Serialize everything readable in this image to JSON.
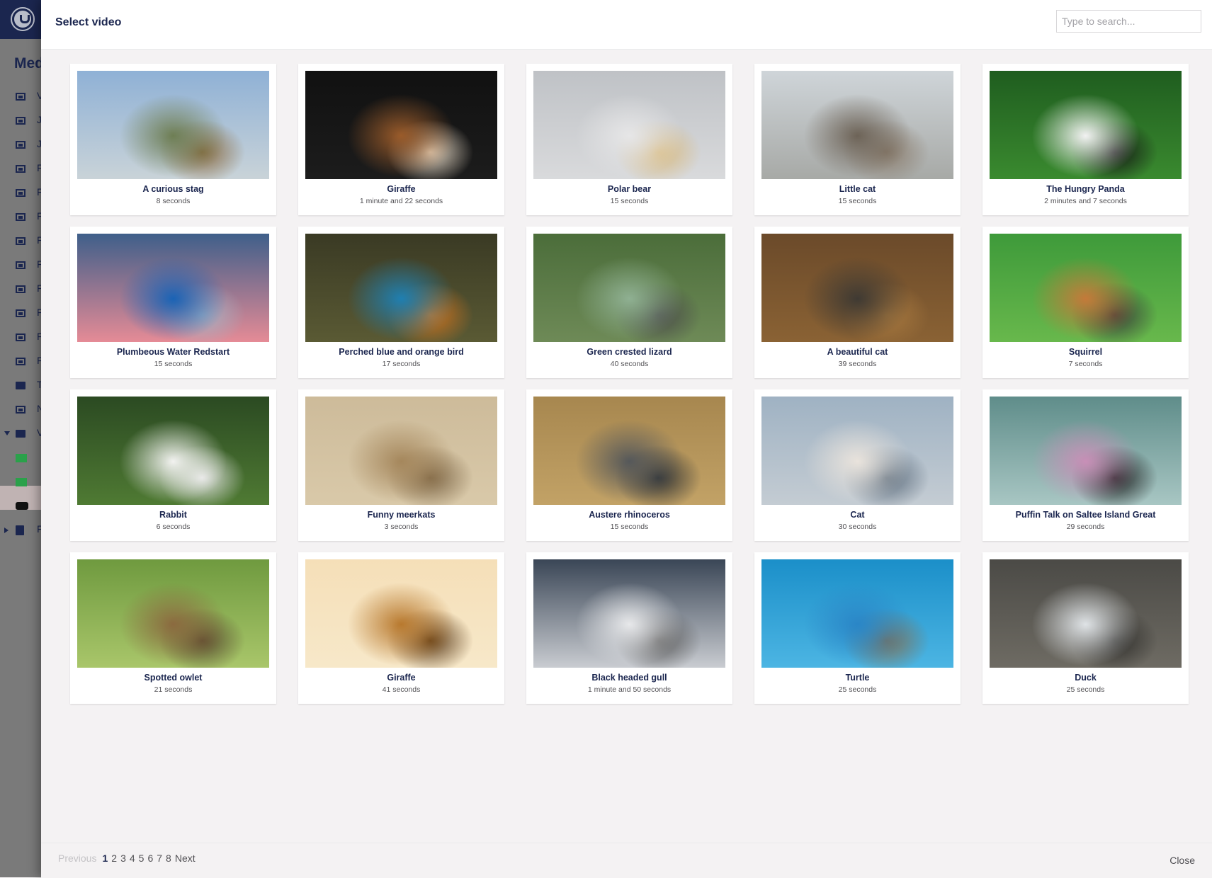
{
  "background_app": {
    "section_heading": "Med",
    "tree_letters": [
      "V",
      "J",
      "J",
      "F",
      "F",
      "F",
      "F",
      "F",
      "F",
      "F",
      "F",
      "F",
      "T",
      "N",
      "V",
      "",
      "",
      "",
      "F"
    ]
  },
  "modal": {
    "title": "Select video",
    "search": {
      "placeholder": "Type to search...",
      "value": ""
    },
    "videos": [
      {
        "name": "A curious stag",
        "duration": "8 seconds",
        "palette": [
          "#8fb1d6",
          "#c9d3d8",
          "#6e7e54",
          "#8a6a3f"
        ]
      },
      {
        "name": "Giraffe",
        "duration": "1 minute and 22 seconds",
        "palette": [
          "#111111",
          "#1c1c1c",
          "#9a5b2a",
          "#e9dcc8"
        ]
      },
      {
        "name": "Polar bear",
        "duration": "15 seconds",
        "palette": [
          "#bfc2c6",
          "#d9dadc",
          "#e6e6e7",
          "#d8b97c"
        ]
      },
      {
        "name": "Little cat",
        "duration": "15 seconds",
        "palette": [
          "#cfd5d9",
          "#a7a9a6",
          "#6d6357",
          "#8a7c6c"
        ]
      },
      {
        "name": "The Hungry Panda",
        "duration": "2 minutes and 7 seconds",
        "palette": [
          "#1f5d1f",
          "#3a8a2f",
          "#f2f2f2",
          "#141414"
        ]
      },
      {
        "name": "Plumbeous Water Redstart",
        "duration": "15 seconds",
        "palette": [
          "#3f5f8a",
          "#e58b96",
          "#1a63b5",
          "#a6b1c2"
        ]
      },
      {
        "name": "Perched blue and orange bird",
        "duration": "17 seconds",
        "palette": [
          "#3a3a24",
          "#5a5a34",
          "#1f7fb1",
          "#d0741f"
        ]
      },
      {
        "name": "Green crested lizard",
        "duration": "40 seconds",
        "palette": [
          "#4b6d3a",
          "#6e8a57",
          "#8fb092",
          "#4a4a4a"
        ]
      },
      {
        "name": "A beautiful cat",
        "duration": "39 seconds",
        "palette": [
          "#6b4a2a",
          "#8a6234",
          "#3f3a33",
          "#a8793f"
        ]
      },
      {
        "name": "Squirrel",
        "duration": "7 seconds",
        "palette": [
          "#3e9a3a",
          "#68b84c",
          "#c47a3a",
          "#3a3a3a"
        ]
      },
      {
        "name": "Rabbit",
        "duration": "6 seconds",
        "palette": [
          "#2b4a22",
          "#4f7a33",
          "#f2f2f0",
          "#e5e5e5"
        ]
      },
      {
        "name": "Funny meerkats",
        "duration": "3 seconds",
        "palette": [
          "#cdbb9a",
          "#d9c9a9",
          "#a5875c",
          "#7d6646"
        ]
      },
      {
        "name": "Austere rhinoceros",
        "duration": "15 seconds",
        "palette": [
          "#a7874f",
          "#c2a266",
          "#55585a",
          "#2f3234"
        ]
      },
      {
        "name": "Cat",
        "duration": "30 seconds",
        "palette": [
          "#9fb2c3",
          "#c4ccd3",
          "#e9e3dc",
          "#5a6a7a"
        ]
      },
      {
        "name": "Puffin Talk on Saltee Island Great",
        "duration": "29 seconds",
        "palette": [
          "#5f8d8a",
          "#a8c6c3",
          "#c88fb7",
          "#1a1a1a"
        ]
      },
      {
        "name": "Spotted owlet",
        "duration": "21 seconds",
        "palette": [
          "#6f9a3f",
          "#a9c66a",
          "#8b6a3f",
          "#5a4a30"
        ]
      },
      {
        "name": "Giraffe",
        "duration": "41 seconds",
        "palette": [
          "#f5dfb8",
          "#f7e8c9",
          "#b8792e",
          "#5a3a18"
        ]
      },
      {
        "name": "Black headed gull",
        "duration": "1 minute and 50 seconds",
        "palette": [
          "#3a4656",
          "#c9ccd1",
          "#e7e8ea",
          "#5a5a5a"
        ]
      },
      {
        "name": "Turtle",
        "duration": "25 seconds",
        "palette": [
          "#1b8fc9",
          "#4cb5e3",
          "#2a86c7",
          "#7e6f55"
        ]
      },
      {
        "name": "Duck",
        "duration": "25 seconds",
        "palette": [
          "#4b4a46",
          "#6e6b63",
          "#dfe3e6",
          "#2e2d2a"
        ]
      }
    ],
    "pagination": {
      "previous_label": "Previous",
      "pages": [
        "1",
        "2",
        "3",
        "4",
        "5",
        "6",
        "7",
        "8"
      ],
      "current_page": "1",
      "next_label": "Next"
    },
    "close_label": "Close"
  }
}
